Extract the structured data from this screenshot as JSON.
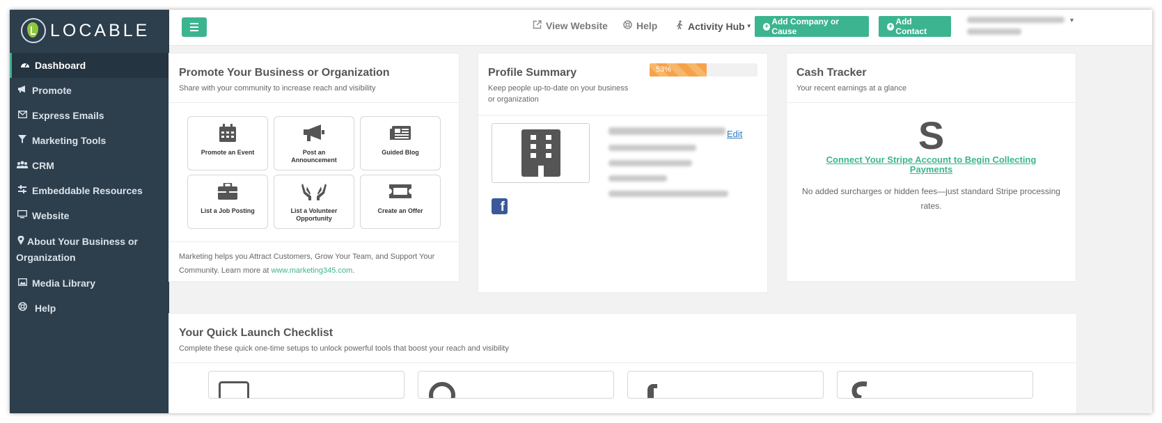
{
  "brand": {
    "name": "LOCABLE",
    "accent": "#3cb48f",
    "sidebar_bg": "#2d3e4c"
  },
  "sidebar": {
    "items": [
      {
        "label": "Dashboard",
        "icon": "dashboard-gauge-icon",
        "active": true
      },
      {
        "label": "Promote",
        "icon": "megaphone-icon"
      },
      {
        "label": "Express Emails",
        "icon": "envelope-icon"
      },
      {
        "label": "Marketing Tools",
        "icon": "filter-funnel-icon"
      },
      {
        "label": "CRM",
        "icon": "users-icon"
      },
      {
        "label": "Embeddable Resources",
        "icon": "sliders-icon"
      },
      {
        "label": "Website",
        "icon": "monitor-icon"
      },
      {
        "label": "About Your Business or Organization",
        "icon": "map-pin-icon"
      },
      {
        "label": "Media Library",
        "icon": "image-icon"
      },
      {
        "label": "Help",
        "icon": "lifebuoy-icon"
      }
    ]
  },
  "topbar": {
    "menu_icon": "hamburger-menu-icon",
    "view_website": "View Website",
    "help": "Help",
    "activity_hub": "Activity Hub",
    "add_company": "Add Company or Cause",
    "add_contact": "Add Contact"
  },
  "promote": {
    "title": "Promote Your Business or Organization",
    "subtitle": "Share with your community to increase reach and visibility",
    "tiles": [
      {
        "label": "Promote an Event",
        "icon": "calendar-icon"
      },
      {
        "label": "Post an Announcement",
        "icon": "megaphone-icon"
      },
      {
        "label": "Guided Blog",
        "icon": "newspaper-icon"
      },
      {
        "label": "List a Job Posting",
        "icon": "briefcase-icon"
      },
      {
        "label": "List a Volunteer Opportunity",
        "icon": "helping-hands-icon"
      },
      {
        "label": "Create an Offer",
        "icon": "ticket-icon"
      }
    ],
    "footer_text": "Marketing helps you Attract Customers, Grow Your Team, and Support Your Community. Learn more at ",
    "footer_link": "www.marketing345.com",
    "footer_end": "."
  },
  "profile": {
    "title": "Profile Summary",
    "subtitle": "Keep people up-to-date on your business or organization",
    "progress_percent": 53,
    "progress_label": "53%",
    "edit": "Edit",
    "image_icon": "building-icon",
    "social_icon": "facebook-icon"
  },
  "cash": {
    "title": "Cash Tracker",
    "subtitle": "Your recent earnings at a glance",
    "stripe_glyph": "S",
    "connect": "Connect Your Stripe Account to Begin Collecting Payments",
    "note": "No added surcharges or hidden fees—just standard Stripe processing rates."
  },
  "checklist": {
    "title": "Your Quick Launch Checklist",
    "subtitle": "Complete these quick one-time setups to unlock powerful tools that boost your reach and visibility"
  }
}
